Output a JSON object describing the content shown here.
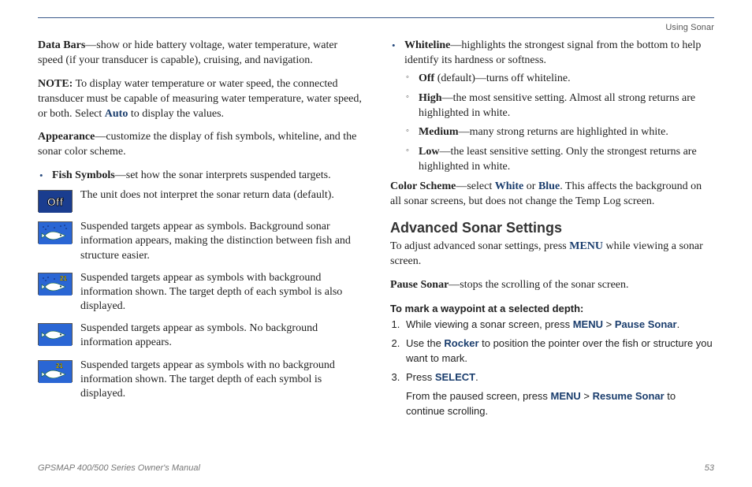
{
  "running_head": "Using Sonar",
  "left": {
    "data_bars_label": "Data Bars",
    "data_bars_text": "—show or hide battery voltage, water temperature, water speed (if your transducer is capable), cruising, and navigation.",
    "note_label": "NOTE:",
    "note_text": " To display water temperature or water speed, the connected transducer must be capable of measuring water temperature, water speed, or both. Select ",
    "note_auto": "Auto",
    "note_tail": " to display the values.",
    "appearance_label": "Appearance",
    "appearance_text": "—customize the display of fish symbols, whiteline, and the sonar color scheme.",
    "fish_symbols_label": "Fish Symbols",
    "fish_symbols_text": "—set how the sonar interprets suspended targets.",
    "rows": [
      {
        "text": "The unit does not interpret the sonar return data (default)."
      },
      {
        "text": "Suspended targets appear as symbols. Background sonar information appears, making the distinction between fish and structure easier."
      },
      {
        "text": "Suspended targets appear as symbols with background information shown. The target depth of each symbol is also displayed."
      },
      {
        "text": "Suspended targets appear as symbols. No background information appears."
      },
      {
        "text": "Suspended targets appear as symbols with no background information shown. The target depth of each symbol is displayed."
      }
    ]
  },
  "right": {
    "whiteline_label": "Whiteline",
    "whiteline_text": "—highlights the strongest signal from the bottom to help identify its hardness or softness.",
    "wl_options": [
      {
        "name": "Off",
        "tail": " (default)—turns off whiteline."
      },
      {
        "name": "High",
        "tail": "—the most sensitive setting. Almost all strong returns are highlighted in white."
      },
      {
        "name": "Medium",
        "tail": "—many strong returns are highlighted in white."
      },
      {
        "name": "Low",
        "tail": "—the least sensitive setting. Only the strongest returns are highlighted in white."
      }
    ],
    "color_scheme_label": "Color Scheme",
    "color_scheme_pre": "—select ",
    "color_white": "White",
    "color_or": " or ",
    "color_blue": "Blue",
    "color_tail": ". This affects the background on all sonar screens, but does not change the Temp Log screen.",
    "h2": "Advanced Sonar Settings",
    "adv_text_pre": "To adjust advanced sonar settings, press ",
    "adv_menu": "MENU",
    "adv_text_post": " while viewing a sonar screen.",
    "pause_label": "Pause Sonar",
    "pause_text": "—stops the scrolling of the sonar screen.",
    "subhead": "To mark a waypoint at a selected depth:",
    "steps": {
      "s1_pre": "While viewing a sonar screen, press ",
      "s1_menu": "MENU",
      "s1_gt": " > ",
      "s1_pause": "Pause Sonar",
      "s1_post": ".",
      "s2_pre": "Use the ",
      "s2_rocker": "Rocker",
      "s2_post": " to position the pointer over the fish or structure you want to mark.",
      "s3_pre": "Press ",
      "s3_select": "SELECT",
      "s3_post": "."
    },
    "resume_pre": "From the paused screen, press ",
    "resume_menu": "MENU",
    "resume_gt": " > ",
    "resume_label": "Resume Sonar",
    "resume_post": " to continue scrolling."
  },
  "footer": {
    "manual": "GPSMAP 400/500 Series Owner's Manual",
    "page": "53"
  }
}
